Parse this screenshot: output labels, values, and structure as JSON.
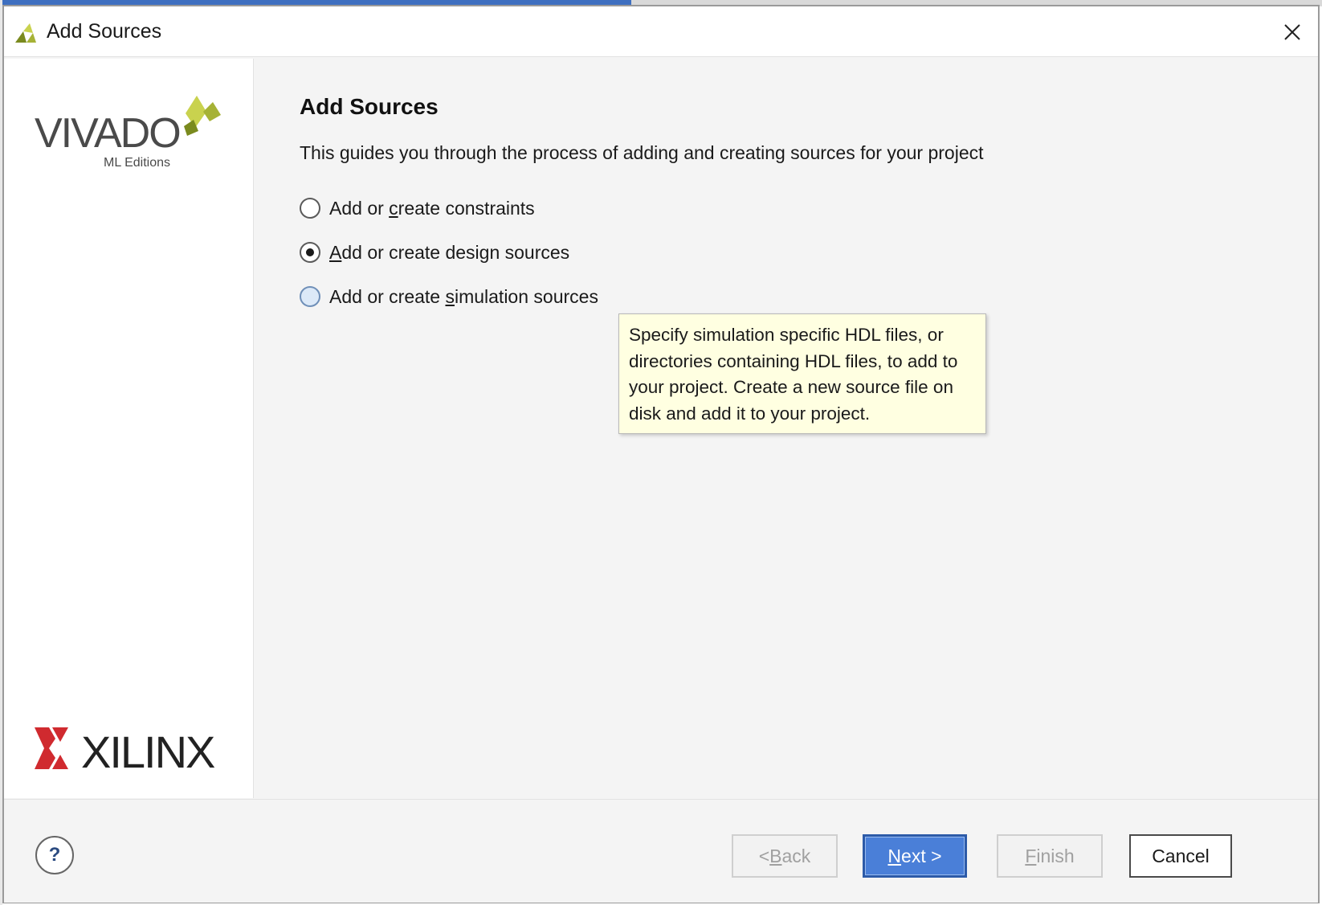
{
  "window": {
    "title": "Add Sources"
  },
  "sidebar": {
    "vivado_logo_text": "VIVADO",
    "vivado_logo_subtext": "ML Editions",
    "xilinx_logo_text": "XILINX"
  },
  "content": {
    "heading": "Add Sources",
    "description": "This guides you through the process of adding and creating sources for your project",
    "options": [
      {
        "pre": "Add or ",
        "mnemonic": "c",
        "post": "reate constraints",
        "selected": false
      },
      {
        "pre": "",
        "mnemonic": "A",
        "post": "dd or create design sources",
        "selected": true
      },
      {
        "pre": "Add or create ",
        "mnemonic": "s",
        "post": "imulation sources",
        "selected": false,
        "hovered": true
      }
    ],
    "tooltip": "Specify simulation specific HDL files, or directories containing HDL files, to add to your project. Create a new source file on disk and add it to your project."
  },
  "footer": {
    "help_label": "?",
    "back": {
      "pre": "< ",
      "mnemonic": "B",
      "post": "ack",
      "enabled": false
    },
    "next": {
      "pre": "",
      "mnemonic": "N",
      "post": "ext >",
      "enabled": true
    },
    "finish": {
      "pre": "",
      "mnemonic": "F",
      "post": "inish",
      "enabled": false
    },
    "cancel": {
      "label": "Cancel",
      "enabled": true
    }
  },
  "colors": {
    "accent_blue": "#4a7fd8",
    "tooltip_bg": "#ffffe1",
    "xilinx_red": "#d02a2f",
    "vivado_green": "#b6c244"
  }
}
